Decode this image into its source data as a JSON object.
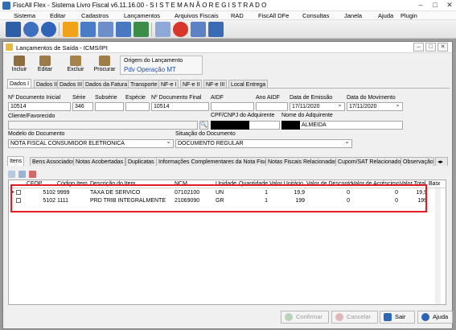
{
  "window": {
    "title": "FiscAll Flex - Sistema Livro Fiscal v6.11.16.00 - S I S T E M A  N Ã O  R E G I S T R A D O",
    "minimize": "–",
    "maximize": "□",
    "close": "✕"
  },
  "menu": [
    "Sistema",
    "Editar",
    "Cadastros",
    "Lançamentos",
    "Arquivos Fiscais",
    "RAD",
    "FiscAll DFe",
    "Consultas",
    "Janela",
    "Ajuda",
    "Plugin"
  ],
  "toolbar_icons": [
    "exit-icon",
    "user-icon",
    "help-icon",
    "lightning-icon",
    "company-icon",
    "products-icon",
    "purchase-icon",
    "sales-icon",
    "mail-icon",
    "calendar-icon",
    "stop-icon",
    "invoice-icon",
    "users-icon",
    "users-add-icon"
  ],
  "child": {
    "title": "Lançamentos de Saída - ICMS/IPI",
    "buttons": {
      "incluir": "Incluir",
      "editar": "Editar",
      "excluir": "Excluir",
      "procurar": "Procurar"
    },
    "origin": {
      "label": "Origem do Lançamento",
      "value": "Pdv Operação MT"
    }
  },
  "tabs": [
    "Dados I",
    "Dados II",
    "Dados III",
    "Dados da Fatura",
    "Transporte",
    "NF-e I",
    "NF-e II",
    "NF-e III",
    "Local Entrega"
  ],
  "form": {
    "doc_inicial": {
      "label": "Nº Documento Inicial",
      "value": "10514"
    },
    "serie": {
      "label": "Série",
      "value": "346"
    },
    "subserie": {
      "label": "Subsérie",
      "value": ""
    },
    "especie": {
      "label": "Espécie",
      "value": ""
    },
    "doc_final": {
      "label": "Nº Documento Final",
      "value": "10514"
    },
    "aidf": {
      "label": "AIDF",
      "value": ""
    },
    "ano_aidf": {
      "label": "Ano AIDF",
      "value": ""
    },
    "data_emissao": {
      "label": "Data de Emissão",
      "value": "17/11/2020"
    },
    "data_movimento": {
      "label": "Data do Movimento",
      "value": "17/11/2020"
    },
    "cliente": {
      "label": "Cliente/Favorecido",
      "value": ""
    },
    "cpf_adquirente": {
      "label": "CPF/CNPJ do Adquirente",
      "value": ""
    },
    "nome_adquirente": {
      "label": "Nome do Adquirente",
      "value": "ALMEIDA"
    },
    "modelo": {
      "label": "Modelo do Documento",
      "value": "NOTA FISCAL CONSUMIDOR ELETRONICA"
    },
    "situacao": {
      "label": "Situação do Documento",
      "value": "DOCUMENTO REGULAR"
    }
  },
  "subtabs": [
    "Itens",
    "Bens Associados",
    "Notas Acobertadas",
    "Duplicatas",
    "Informações Complementares da Nota Fiscal",
    "Notas Fiscais Relacionadas",
    "Cupom/SAT Relacionados",
    "Observação do"
  ],
  "grid": {
    "columns": [
      "CFOP",
      "Código Item",
      "Descrição do Item",
      "NCM",
      "Unidade",
      "Quantidade",
      "Valor Unitário",
      "Valor de Desconto",
      "Valor de Acréscimo",
      "Valor Total",
      "Base c"
    ],
    "rows": [
      {
        "cfop": "5102",
        "codigo": "9999",
        "descricao": "TAXA DE SERVICO",
        "ncm": "07102100",
        "unidade": "UN",
        "quantidade": "1",
        "unitario": "19,9",
        "desconto": "0",
        "acrescimo": "0",
        "total": "19,9"
      },
      {
        "cfop": "5102",
        "codigo": "1111",
        "descricao": "PRD TRIB INTEGRALMENTE",
        "ncm": "21069090",
        "unidade": "GR",
        "quantidade": "1",
        "unitario": "199",
        "desconto": "0",
        "acrescimo": "0",
        "total": "199"
      }
    ],
    "current_row_marker": "▶"
  },
  "bottom_buttons": {
    "confirmar": "Confirmar",
    "cancelar": "Cancelar",
    "sair": "Sair",
    "ajuda": "Ajuda"
  },
  "colors": {
    "accent_blue": "#1f4fa8",
    "highlight_red": "#e21c23",
    "mdi_background": "#9a9a9a"
  }
}
